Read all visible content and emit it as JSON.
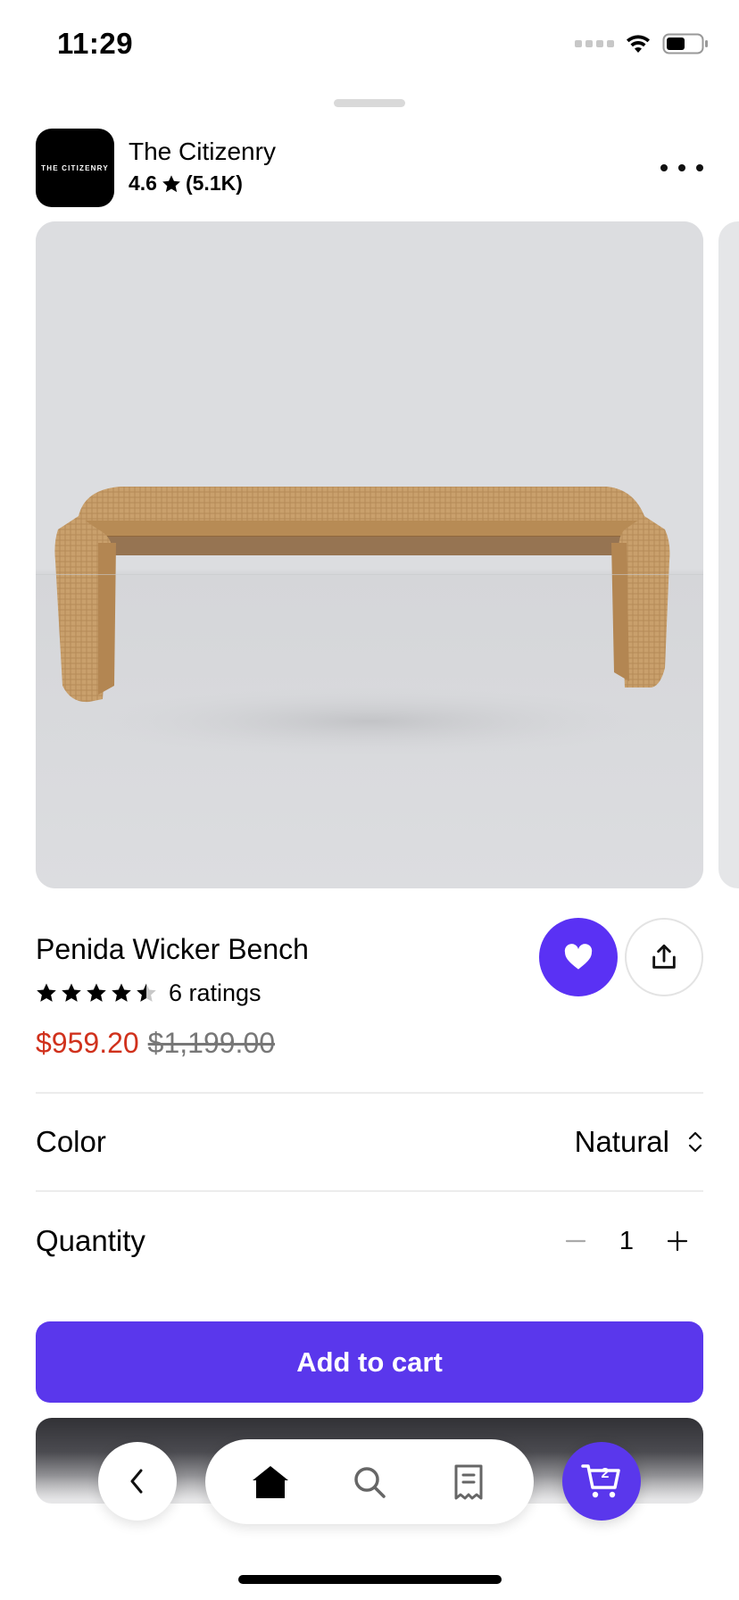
{
  "status_bar": {
    "time": "11:29",
    "icons": [
      "signal-icon",
      "wifi-icon",
      "battery-icon"
    ]
  },
  "shop": {
    "logo_text": "THE CITIZENRY",
    "name": "The Citizenry",
    "rating": "4.6",
    "review_count": "(5.1K)",
    "more_icon": "more-dots-icon"
  },
  "product": {
    "title": "Penida Wicker Bench",
    "rating_value": 4.5,
    "ratings_label": "6 ratings",
    "sale_price": "$959.20",
    "original_price": "$1,199.00",
    "favorited": true
  },
  "options": {
    "color_label": "Color",
    "color_value": "Natural",
    "quantity_label": "Quantity",
    "quantity_value": "1"
  },
  "actions": {
    "add_to_cart": "Add to cart"
  },
  "nav": {
    "items": [
      "back-icon",
      "home-icon",
      "search-icon",
      "orders-icon",
      "cart-icon"
    ],
    "cart_count": "2"
  },
  "colors": {
    "accent": "#5a37ec",
    "sale_price": "#d0311c"
  }
}
